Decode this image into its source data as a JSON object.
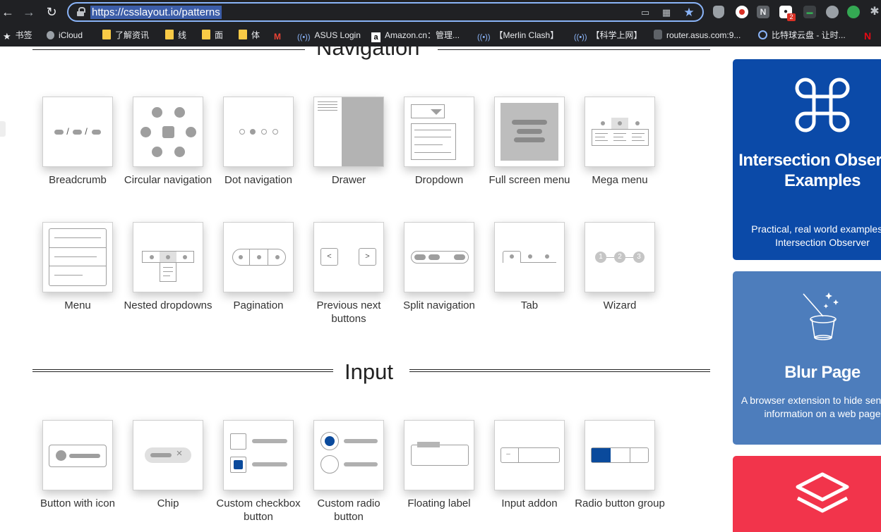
{
  "browser": {
    "url": "https://csslayout.io/patterns",
    "bookmarks": [
      {
        "label": "书签",
        "icon": "star-icon"
      },
      {
        "label": "iCloud",
        "icon": "apple-icon"
      },
      {
        "label": "了解资讯",
        "icon": "folder-icon"
      },
      {
        "label": "线",
        "icon": "folder-icon"
      },
      {
        "label": "面",
        "icon": "folder-icon"
      },
      {
        "label": "体",
        "icon": "folder-icon"
      },
      {
        "label": "",
        "icon": "gmail-icon"
      },
      {
        "label": "ASUS Login",
        "icon": "signal-icon"
      },
      {
        "label": "Amazon.cn：管理...",
        "icon": "amazon-icon"
      },
      {
        "label": "【Merlin Clash】",
        "icon": "signal-icon"
      },
      {
        "label": "【科学上网】",
        "icon": "signal-icon"
      },
      {
        "label": "router.asus.com:9...",
        "icon": "cat-icon"
      },
      {
        "label": "比特球云盘 - 让时...",
        "icon": "cloud-icon"
      },
      {
        "label": "",
        "icon": "netflix-icon"
      }
    ],
    "extension_badge": "2"
  },
  "sections": {
    "navigation": {
      "title": "Navigation",
      "items": [
        "Breadcrumb",
        "Circular navigation",
        "Dot navigation",
        "Drawer",
        "Dropdown",
        "Full screen menu",
        "Mega menu",
        "Menu",
        "Nested dropdowns",
        "Pagination",
        "Previous next buttons",
        "Split navigation",
        "Tab",
        "Wizard"
      ]
    },
    "input": {
      "title": "Input",
      "items": [
        "Button with icon",
        "Chip",
        "Custom checkbox button",
        "Custom radio button",
        "Floating label",
        "Input addon",
        "Radio button group"
      ]
    }
  },
  "thumbnails": {
    "breadcrumb_separator": "/",
    "prev_symbol": "<",
    "next_symbol": ">",
    "wizard_steps": [
      "1",
      "2",
      "3"
    ],
    "chip_close": "×",
    "addon_symbol": "–"
  },
  "ads": [
    {
      "title": "Intersection Observer Examples",
      "description": "Practical, real world examples of Intersection Observer",
      "color": "#0b4aa8",
      "icon": "command-icon"
    },
    {
      "title": "Blur Page",
      "description": "A browser extension to hide sensitive information on a web page",
      "color": "#4d7dbc",
      "icon": "magic-hat-icon"
    },
    {
      "title": "",
      "description": "",
      "color": "#f2344b",
      "icon": "layers-icon"
    }
  ],
  "colors": {
    "accent": "#0a4a9c",
    "chrome_bg": "#202124",
    "url_highlight": "#3c5da8"
  }
}
